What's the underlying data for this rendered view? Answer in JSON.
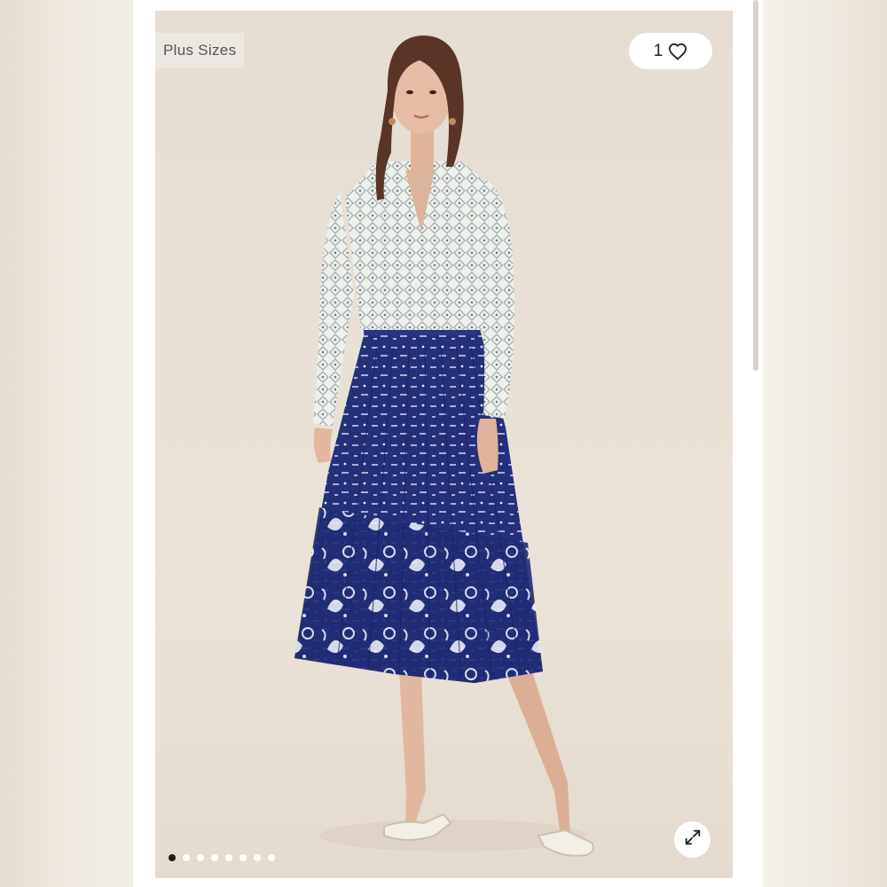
{
  "listing": {
    "tag_label": "Plus Sizes",
    "like_count": "1",
    "carousel": {
      "total_images": 8,
      "active_index": 0
    }
  },
  "icons": {
    "like": "heart-icon",
    "expand": "expand-icon"
  },
  "colors": {
    "skirt_navy": "#24307a",
    "background": "#e8e0d4",
    "active_dot": "#1b1b1b"
  }
}
